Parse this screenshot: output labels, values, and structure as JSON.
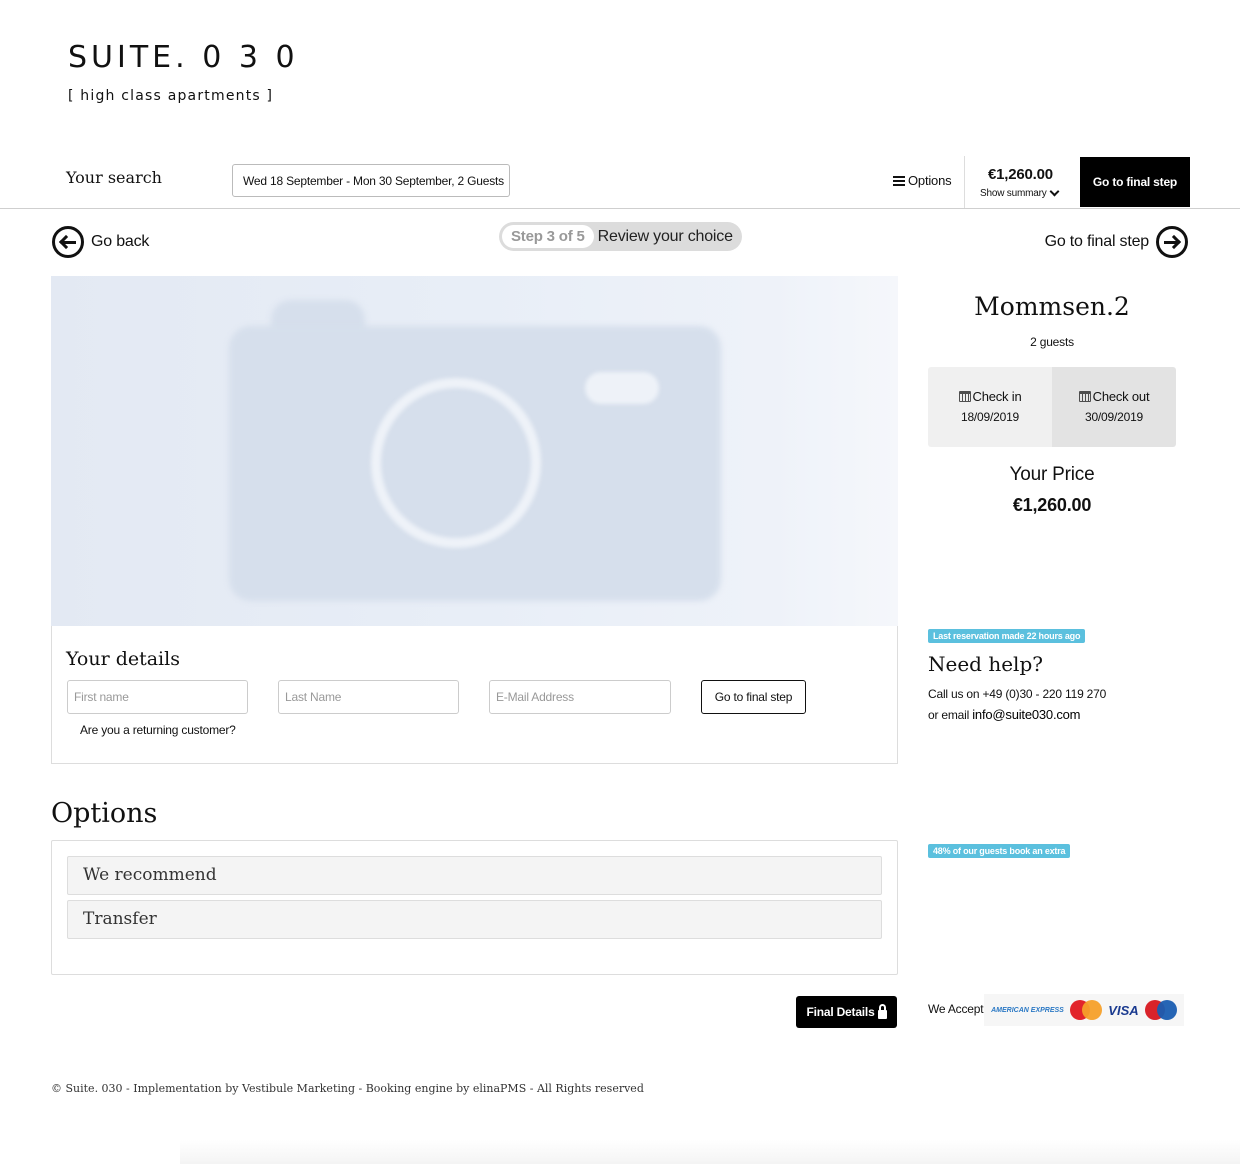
{
  "brand": {
    "name": "SUITE. 0 3 0",
    "tagline": "[ high class apartments ]"
  },
  "search_bar": {
    "label": "Your search",
    "value": "Wed 18 September - Mon 30 September, 2 Guests",
    "options_label": "Options",
    "total_price": "€1,260.00",
    "show_summary": "Show summary",
    "final_step_button": "Go to final step"
  },
  "step_nav": {
    "back_label": "Go back",
    "step_count": "Step 3 of 5",
    "step_title": "Review your choice",
    "forward_label": "Go to final step"
  },
  "details": {
    "title": "Your details",
    "first_name_placeholder": "First name",
    "last_name_placeholder": "Last Name",
    "email_placeholder": "E-Mail Address",
    "submit_label": "Go to final step",
    "returning_customer": "Are you a returning customer?"
  },
  "options_section": {
    "title": "Options",
    "items": [
      {
        "label": "We recommend"
      },
      {
        "label": "Transfer"
      }
    ],
    "final_details_button": "Final Details"
  },
  "sidebar": {
    "apartment_name": "Mommsen.2",
    "guests": "2 guests",
    "check_in_label": "Check in",
    "check_in_date": "18/09/2019",
    "check_out_label": "Check out",
    "check_out_date": "30/09/2019",
    "your_price_label": "Your Price",
    "your_price_value": "€1,260.00",
    "badge_last_reservation": "Last reservation made 22 hours ago",
    "need_help_title": "Need help?",
    "call_us": "Call us on +49 (0)30 - 220 119 270",
    "email_prefix": "or email",
    "email_address": "info@suite030.com",
    "badge_extra": "48% of our guests book an extra",
    "we_accept": "We Accept",
    "cards": [
      "AMERICAN EXPRESS",
      "MasterCard",
      "VISA",
      "Maestro"
    ]
  },
  "footer": {
    "text": "© Suite. 030 - Implementation by Vestibule Marketing - Booking engine by elinaPMS - All Rights reserved"
  },
  "colors": {
    "accent_badge": "#5bc0de",
    "button_dark": "#000000",
    "photo_placeholder": "#d6dfec"
  }
}
